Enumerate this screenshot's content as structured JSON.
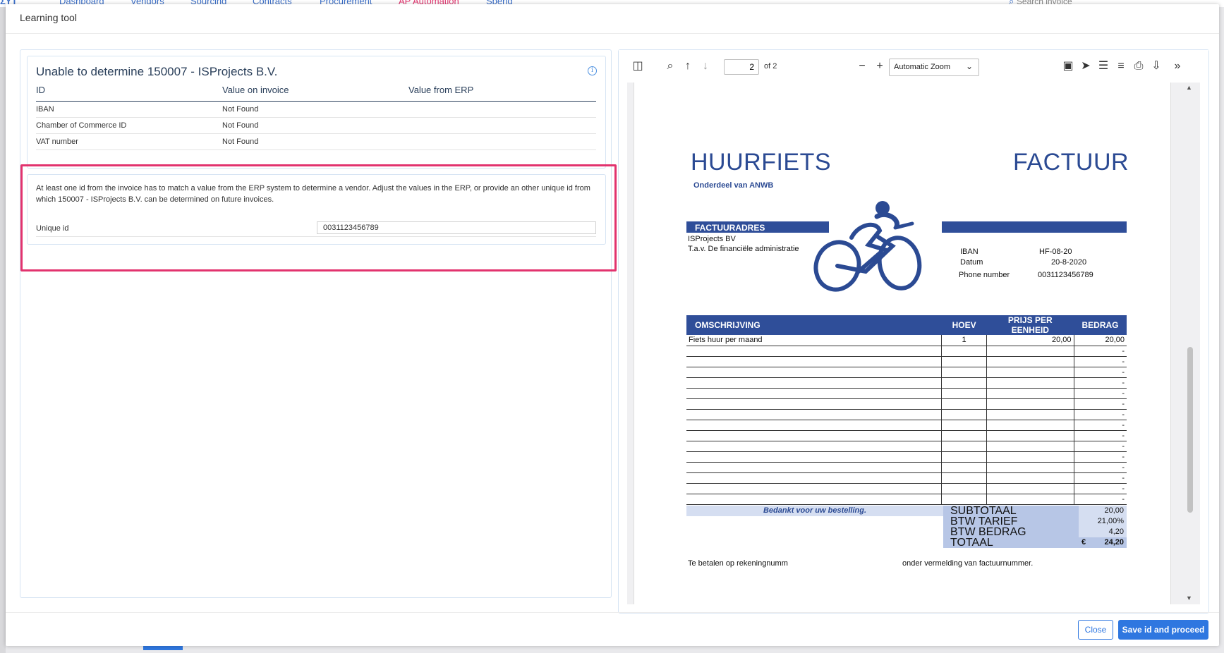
{
  "background_app": {
    "nav": [
      "Dashboard",
      "Vendors",
      "Sourcing",
      "Contracts",
      "Procurement",
      "AP Automation",
      "Spend"
    ],
    "search_placeholder": "Search invoice"
  },
  "modal": {
    "title": "Learning tool",
    "close_label": "Close",
    "save_label": "Save id and proceed"
  },
  "vendor_card": {
    "title": "Unable to determine 150007 - ISProjects B.V.",
    "columns": [
      "ID",
      "Value on invoice",
      "Value from ERP"
    ],
    "rows": [
      {
        "id": "IBAN",
        "invoice": "Not Found",
        "erp": ""
      },
      {
        "id": "Chamber of Commerce ID",
        "invoice": "Not Found",
        "erp": ""
      },
      {
        "id": "VAT number",
        "invoice": "Not Found",
        "erp": ""
      }
    ]
  },
  "unique_card": {
    "message": "At least one id from the invoice has to match a value from the ERP system to determine a vendor. Adjust the values in the ERP, or provide an other unique id from which 150007 - ISProjects B.V. can be determined on future invoices.",
    "label": "Unique id",
    "value": "0031123456789"
  },
  "pdf_toolbar": {
    "page": "2",
    "page_of": "of 2",
    "zoom": "Automatic Zoom"
  },
  "invoice": {
    "brand": "HUURFIETS",
    "doc_title": "FACTUUR",
    "sub_brand": "Onderdeel van ANWB",
    "address_header": "FACTUURADRES",
    "address_line1": "ISProjects BV",
    "address_line2": "T.a.v. De financiële administratie",
    "meta": [
      {
        "key": "IBAN",
        "value": "HF-08-20"
      },
      {
        "key": "Datum",
        "value": "20-8-2020"
      },
      {
        "key": "Phone number",
        "value": "0031123456789"
      }
    ],
    "columns": [
      "OMSCHRIJVING",
      "HOEV",
      "PRIJS PER EENHEID",
      "BEDRAG"
    ],
    "line_items": [
      {
        "desc": "Fiets huur per maand",
        "qty": "1",
        "price": "20,00",
        "amount": "20,00"
      },
      {
        "desc": "",
        "qty": "",
        "price": "",
        "amount": "-"
      },
      {
        "desc": "",
        "qty": "",
        "price": "",
        "amount": "-"
      },
      {
        "desc": "",
        "qty": "",
        "price": "",
        "amount": "-"
      },
      {
        "desc": "",
        "qty": "",
        "price": "",
        "amount": "-"
      },
      {
        "desc": "",
        "qty": "",
        "price": "",
        "amount": "-"
      },
      {
        "desc": "",
        "qty": "",
        "price": "",
        "amount": "-"
      },
      {
        "desc": "",
        "qty": "",
        "price": "",
        "amount": "-"
      },
      {
        "desc": "",
        "qty": "",
        "price": "",
        "amount": "-"
      },
      {
        "desc": "",
        "qty": "",
        "price": "",
        "amount": "-"
      },
      {
        "desc": "",
        "qty": "",
        "price": "",
        "amount": "-"
      },
      {
        "desc": "",
        "qty": "",
        "price": "",
        "amount": "-"
      },
      {
        "desc": "",
        "qty": "",
        "price": "",
        "amount": "-"
      },
      {
        "desc": "",
        "qty": "",
        "price": "",
        "amount": "-"
      },
      {
        "desc": "",
        "qty": "",
        "price": "",
        "amount": "-"
      },
      {
        "desc": "",
        "qty": "",
        "price": "",
        "amount": "-"
      }
    ],
    "thanks": "Bedankt voor uw bestelling.",
    "totals": [
      {
        "label": "SUBTOTAAL",
        "value": "20,00"
      },
      {
        "label": "BTW TARIEF",
        "value": "21,00%"
      },
      {
        "label": "BTW BEDRAG",
        "value": "4,20"
      },
      {
        "label": "TOTAAL",
        "value": "24,20",
        "currency": "€"
      }
    ],
    "payment_left": "Te betalen op rekeningnumm",
    "payment_right": "onder vermelding van factuurnummer."
  },
  "colors": {
    "accent": "#2f77e0",
    "highlight": "#e2336e",
    "invoice_blue": "#2f4e99"
  }
}
